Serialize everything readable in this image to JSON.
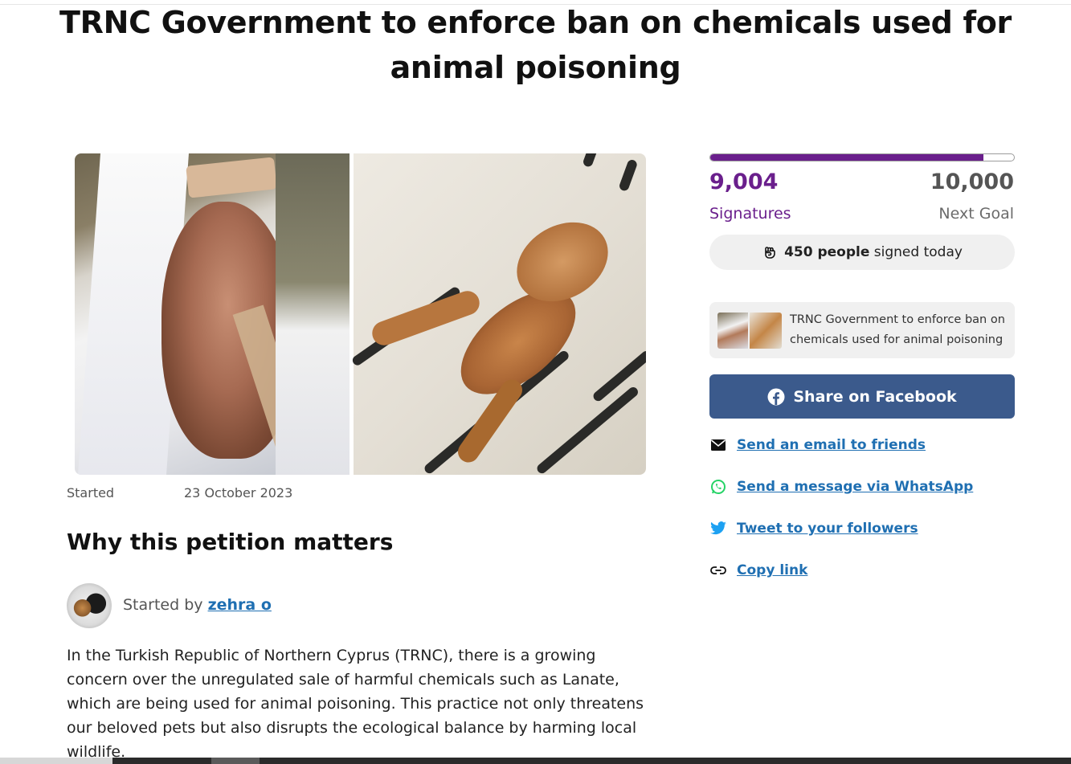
{
  "petition": {
    "title": "TRNC Government to enforce ban on chemicals used for animal poisoning",
    "started_label": "Started",
    "started_date": "23 October 2023",
    "section_heading": "Why this petition matters",
    "started_by_prefix": "Started by",
    "author": "zehra o",
    "body": "In the Turkish Republic of Northern Cyprus (TRNC), there is a growing concern over the unregulated sale of harmful chemicals such as Lanate, which are being used for animal poisoning. This practice not only threatens our beloved pets but also disrupts the ecological balance by harming local wildlife."
  },
  "signatures": {
    "count": "9,004",
    "count_label": "Signatures",
    "goal": "10,000",
    "goal_label": "Next Goal",
    "progress_fraction": 0.9004,
    "today_count": "450 people",
    "today_suffix": "signed today"
  },
  "preview": {
    "text": "TRNC Government to enforce ban on chemicals used for animal poisoning"
  },
  "share": {
    "facebook_label": "Share on Facebook",
    "email_label": "Send an email to friends",
    "whatsapp_label": "Send a message via WhatsApp",
    "twitter_label": "Tweet to your followers",
    "copy_label": "Copy link"
  },
  "icons": {
    "fist": "fist-icon",
    "facebook": "facebook-icon",
    "email": "email-icon",
    "whatsapp": "whatsapp-icon",
    "twitter": "twitter-icon",
    "link": "link-icon"
  },
  "colors": {
    "accent": "#6a1f8c",
    "facebook": "#3b5a8c",
    "link": "#1f6fb2",
    "whatsapp": "#25d366",
    "twitter": "#1da1f2"
  }
}
